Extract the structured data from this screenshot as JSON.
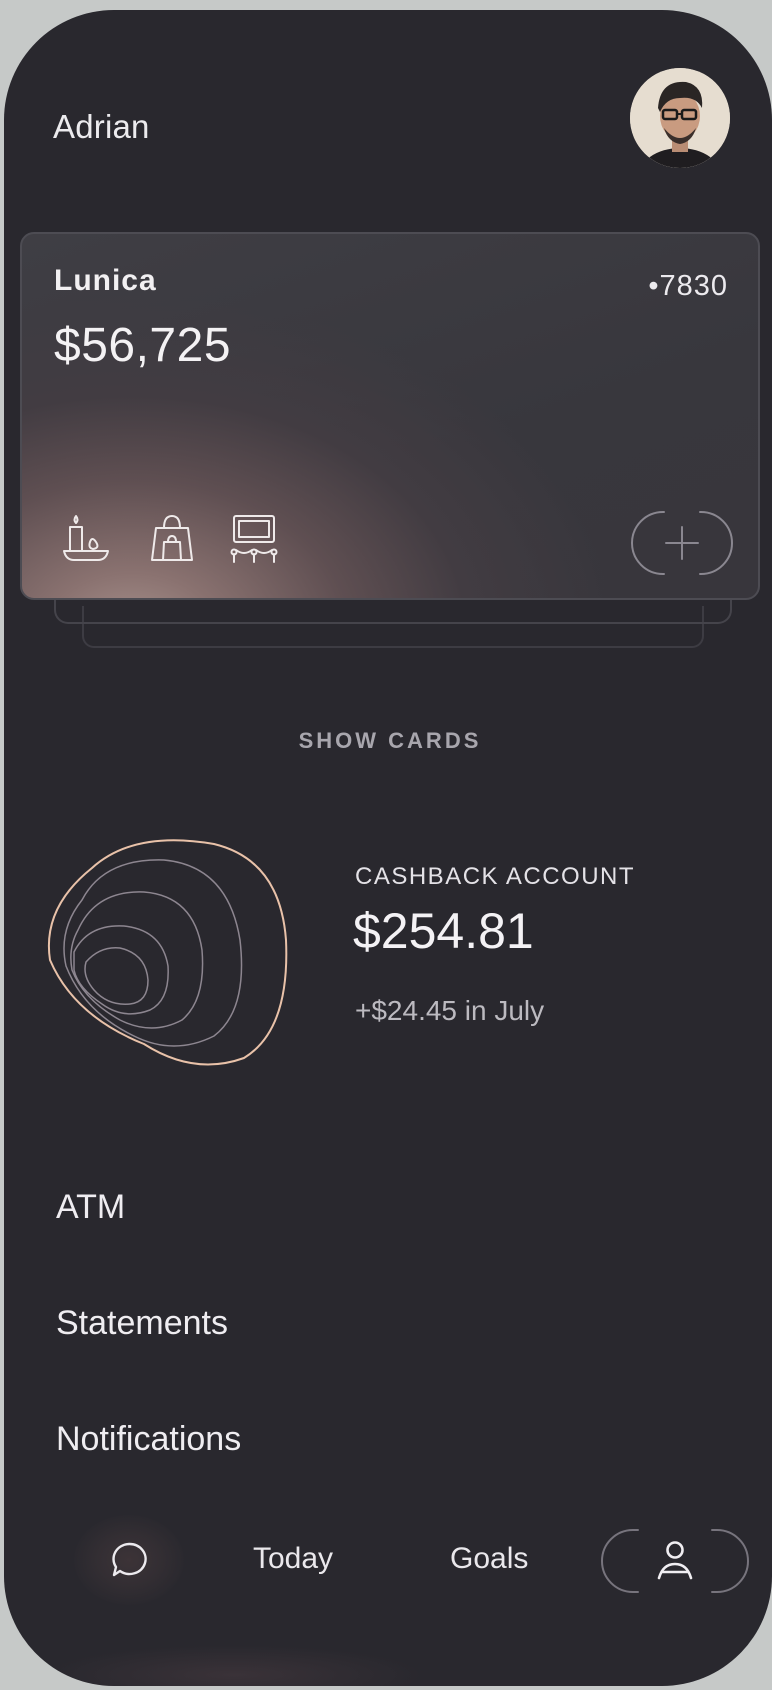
{
  "header": {
    "user_name": "Adrian"
  },
  "card": {
    "brand": "Lunica",
    "last4": "•7830",
    "balance": "$56,725",
    "icons": [
      "candle-icon",
      "shopping-bag-icon",
      "theater-icon"
    ],
    "add_icon": "plus-icon"
  },
  "show_cards_label": "SHOW CARDS",
  "cashback": {
    "label": "CASHBACK ACCOUNT",
    "amount": "$254.81",
    "delta": "+$24.45 in July"
  },
  "menu": {
    "items": [
      {
        "label": "ATM"
      },
      {
        "label": "Statements"
      },
      {
        "label": "Notifications"
      }
    ]
  },
  "nav": {
    "chat_icon": "chat-bubble-icon",
    "today": "Today",
    "goals": "Goals",
    "profile_icon": "person-icon"
  },
  "colors": {
    "background": "#29282e",
    "accent_line": "#e8c0a8",
    "text": "#efedf1"
  }
}
